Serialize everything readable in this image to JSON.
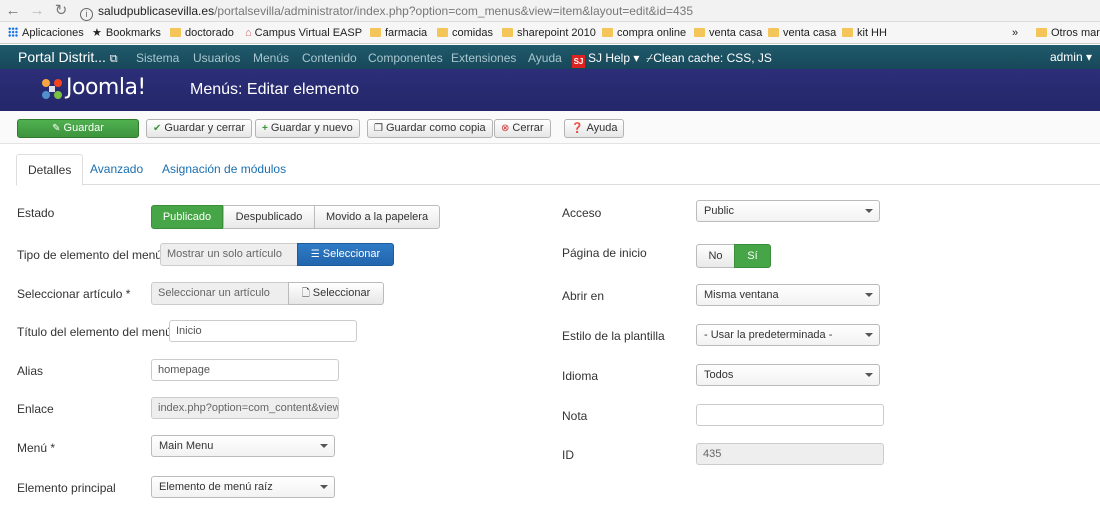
{
  "browser": {
    "url_host": "saludpublicasevilla.es",
    "url_path": "/portalsevilla/administrator/index.php?option=com_menus&view=item&layout=edit&id=435",
    "bookmarks": [
      "Aplicaciones",
      "Bookmarks",
      "doctorado",
      "Campus Virtual EASP",
      "farmacia",
      "comidas",
      "sharepoint 2010",
      "compra online",
      "venta casa",
      "venta casa",
      "kit HH",
      "Otros marc"
    ],
    "overflow": "»"
  },
  "topnav": {
    "brand": "Portal Distrit...",
    "items": [
      "Sistema",
      "Usuarios",
      "Menús",
      "Contenido",
      "Componentes",
      "Extensiones",
      "Ayuda"
    ],
    "sj_help": "SJ Help ▾",
    "clean_cache": "Clean cache: CSS, JS",
    "user": "admin ▾"
  },
  "header": {
    "logo": "Joomla!",
    "title": "Menús: Editar elemento"
  },
  "toolbar": {
    "save": "Guardar",
    "save_close": "Guardar y cerrar",
    "save_new": "Guardar y nuevo",
    "save_copy": "Guardar como copia",
    "close": "Cerrar",
    "help": "Ayuda"
  },
  "tabs": [
    "Detalles",
    "Avanzado",
    "Asignación de módulos"
  ],
  "form_left": {
    "estado": {
      "label": "Estado",
      "options": [
        "Publicado",
        "Despublicado",
        "Movido a la papelera"
      ],
      "selected": "Publicado"
    },
    "tipo": {
      "label": "Tipo de elemento del menú *",
      "value": "Mostrar un solo artículo",
      "button": "Seleccionar"
    },
    "articulo": {
      "label": "Seleccionar artículo *",
      "value": "Seleccionar un artículo",
      "button": "Seleccionar"
    },
    "titulo": {
      "label": "Título del elemento del menú *",
      "value": "Inicio"
    },
    "alias": {
      "label": "Alias",
      "value": "homepage"
    },
    "enlace": {
      "label": "Enlace",
      "value": "index.php?option=com_content&view"
    },
    "menu": {
      "label": "Menú *",
      "value": "Main Menu"
    },
    "principal": {
      "label": "Elemento principal",
      "value": "Elemento de menú raíz"
    }
  },
  "form_right": {
    "acceso": {
      "label": "Acceso",
      "value": "Public"
    },
    "inicio": {
      "label": "Página de inicio",
      "options": [
        "No",
        "Sí"
      ],
      "selected": "Sí"
    },
    "abrir": {
      "label": "Abrir en",
      "value": "Misma ventana"
    },
    "estilo": {
      "label": "Estilo de la plantilla",
      "value": "- Usar la predeterminada -"
    },
    "idioma": {
      "label": "Idioma",
      "value": "Todos"
    },
    "nota": {
      "label": "Nota",
      "value": ""
    },
    "id": {
      "label": "ID",
      "value": "435"
    }
  },
  "colors": {
    "navbar": "#1b5060",
    "header": "#2c2e78",
    "success": "#46a546",
    "primary": "#2266ad",
    "link": "#1a6fb0"
  }
}
